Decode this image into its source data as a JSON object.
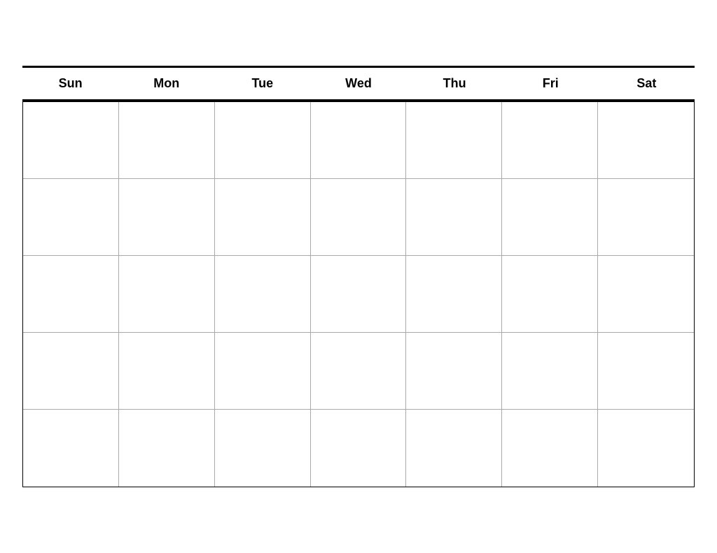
{
  "calendar": {
    "days": [
      {
        "label": "Sun"
      },
      {
        "label": "Mon"
      },
      {
        "label": "Tue"
      },
      {
        "label": "Wed"
      },
      {
        "label": "Thu"
      },
      {
        "label": "Fri"
      },
      {
        "label": "Sat"
      }
    ],
    "rows": 5,
    "cols": 7
  }
}
